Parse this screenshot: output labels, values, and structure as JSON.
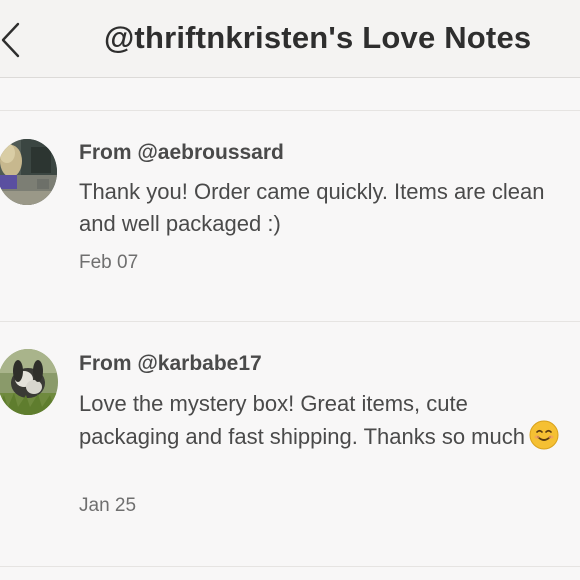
{
  "header": {
    "title": "@thriftnkristen's Love Notes",
    "back_icon": "chevron-left-icon"
  },
  "notes": [
    {
      "sender": "From @aebroussard",
      "message": "Thank you! Order came quickly. Items are clean and well packaged :)",
      "date": "Feb 07"
    },
    {
      "sender": "From @karbabe17",
      "message": "Love the mystery box! Great items, cute packaging and fast shipping. Thanks so much",
      "emoji": "smiling-face-emoji",
      "date": "Jan 25"
    }
  ],
  "colors": {
    "background": "#f8f7f7",
    "header_background": "#f4f3f2",
    "text": "#4a4a4a",
    "muted_text": "#6f6f6f",
    "emoji": "#f5c033"
  }
}
